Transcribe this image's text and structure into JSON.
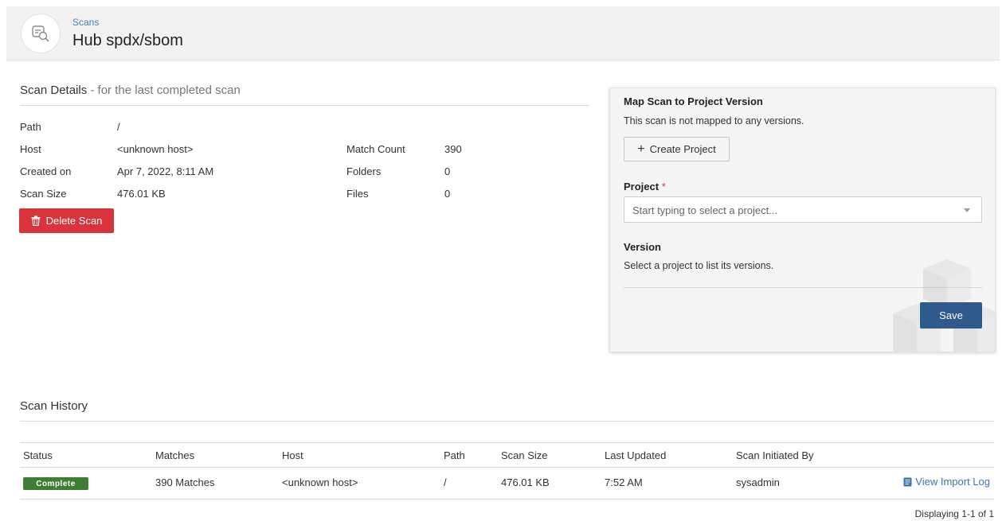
{
  "header": {
    "breadcrumb": "Scans",
    "title": "Hub spdx/sbom",
    "icon": "scan-search-icon"
  },
  "details": {
    "heading": "Scan Details",
    "subheading": " - for the last completed scan",
    "left_fields": [
      {
        "label": "Path",
        "value": "/"
      },
      {
        "label": "Host",
        "value": "<unknown host>"
      },
      {
        "label": "Created on",
        "value": "Apr 7, 2022, 8:11 AM"
      },
      {
        "label": "Scan Size",
        "value": "476.01 KB"
      }
    ],
    "right_fields": [
      {
        "label": "Match Count",
        "value": "390"
      },
      {
        "label": "Folders",
        "value": "0"
      },
      {
        "label": "Files",
        "value": "0"
      }
    ],
    "delete_button": "Delete Scan",
    "delete_color": "#d9333b"
  },
  "map_panel": {
    "heading": "Map Scan to Project Version",
    "description": "This scan is not mapped to any versions.",
    "create_button": "Create Project",
    "project_label": "Project",
    "required_marker": "*",
    "project_placeholder": "Start typing to select a project...",
    "version_label": "Version",
    "version_hint": "Select a project to list its versions.",
    "save_button": "Save",
    "save_color": "#2e5b8c"
  },
  "history": {
    "heading": "Scan History",
    "columns": [
      "Status",
      "Matches",
      "Host",
      "Path",
      "Scan Size",
      "Last Updated",
      "Scan Initiated By"
    ],
    "rows": [
      {
        "status": "Complete",
        "status_color": "#3f7d33",
        "matches": "390 Matches",
        "host": "<unknown host>",
        "path": "/",
        "scan_size": "476.01 KB",
        "last_updated": "7:52 AM",
        "initiated_by": "sysadmin",
        "action": "View Import Log"
      }
    ],
    "pager": "Displaying 1-1 of 1"
  }
}
